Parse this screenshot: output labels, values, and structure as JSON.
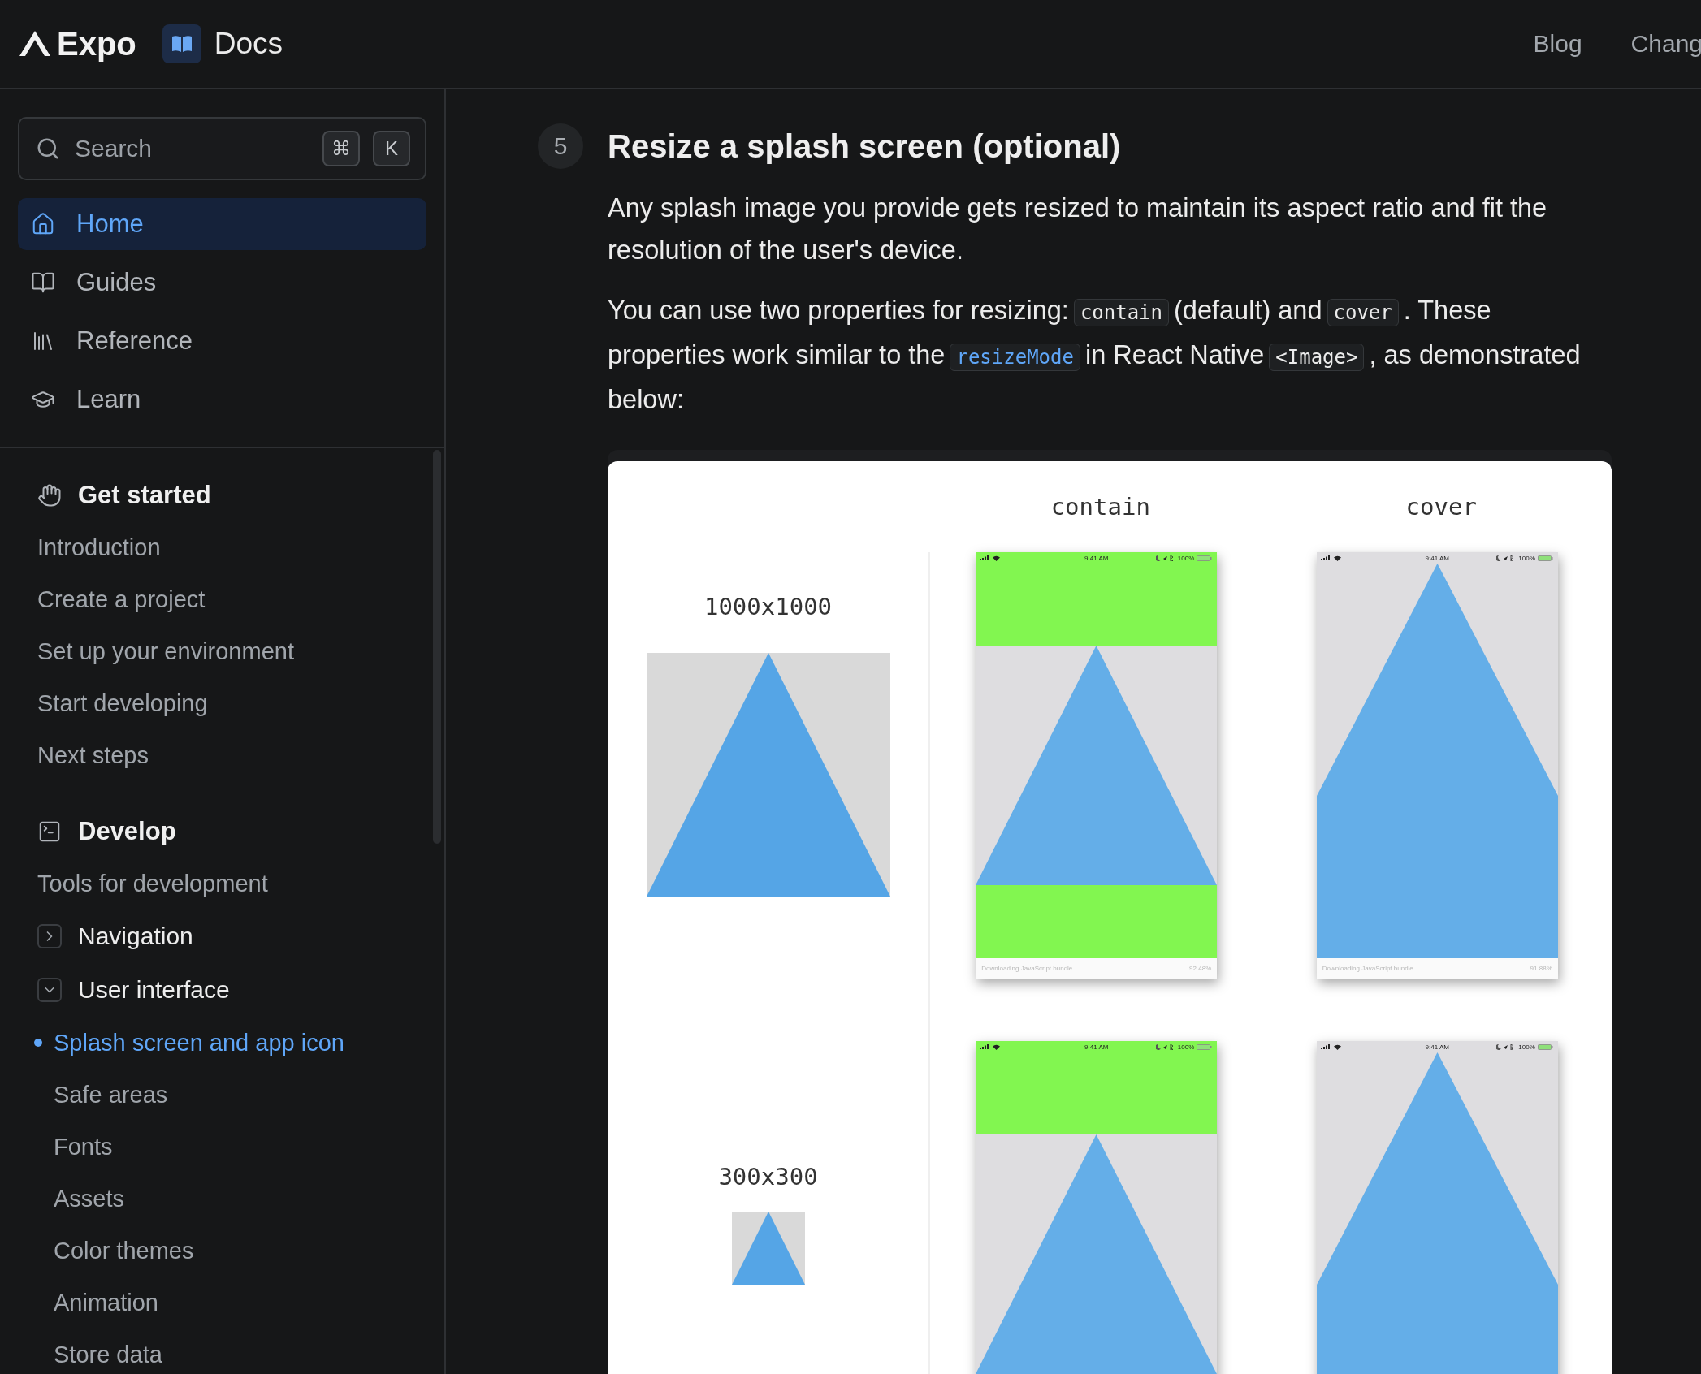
{
  "header": {
    "logo": "Expo",
    "section": "Docs",
    "links": [
      "Blog",
      "Chang"
    ]
  },
  "search": {
    "placeholder": "Search",
    "keys": [
      "⌘",
      "K"
    ]
  },
  "primary_nav": [
    {
      "label": "Home",
      "selected": true
    },
    {
      "label": "Guides",
      "selected": false
    },
    {
      "label": "Reference",
      "selected": false
    },
    {
      "label": "Learn",
      "selected": false
    }
  ],
  "sections": [
    {
      "title": "Get started",
      "items": [
        {
          "kind": "link",
          "label": "Introduction",
          "selected": false
        },
        {
          "kind": "link",
          "label": "Create a project",
          "selected": false
        },
        {
          "kind": "link",
          "label": "Set up your environment",
          "selected": false
        },
        {
          "kind": "link",
          "label": "Start developing",
          "selected": false
        },
        {
          "kind": "link",
          "label": "Next steps",
          "selected": false
        }
      ]
    },
    {
      "title": "Develop",
      "items": [
        {
          "kind": "link",
          "label": "Tools for development",
          "selected": false
        },
        {
          "kind": "group",
          "label": "Navigation",
          "expanded": false
        },
        {
          "kind": "group",
          "label": "User interface",
          "expanded": true,
          "children": [
            {
              "label": "Splash screen and app icon",
              "selected": true
            },
            {
              "label": "Safe areas",
              "selected": false
            },
            {
              "label": "Fonts",
              "selected": false
            },
            {
              "label": "Assets",
              "selected": false
            },
            {
              "label": "Color themes",
              "selected": false
            },
            {
              "label": "Animation",
              "selected": false
            },
            {
              "label": "Store data",
              "selected": false
            }
          ]
        }
      ]
    }
  ],
  "content": {
    "step": "5",
    "heading": "Resize a splash screen (optional)",
    "paragraphs": [
      [
        {
          "kind": "text",
          "text": "Any splash image you provide gets resized to maintain its aspect ratio and fit the resolution of the user's device."
        }
      ],
      [
        {
          "kind": "text",
          "text": "You can use two properties for resizing:"
        },
        {
          "kind": "code",
          "text": "contain"
        },
        {
          "kind": "text",
          "text": "(default) and"
        },
        {
          "kind": "code",
          "text": "cover"
        },
        {
          "kind": "text",
          "text": ". These properties work similar to the"
        },
        {
          "kind": "code_link",
          "text": "resizeMode"
        },
        {
          "kind": "text",
          "text": "in React Native"
        },
        {
          "kind": "code",
          "text": "<Image>"
        },
        {
          "kind": "text",
          "text": ", as demonstrated below:"
        }
      ]
    ],
    "figure": {
      "columns": [
        "contain",
        "cover"
      ],
      "rows": [
        {
          "size": "1000x1000",
          "kind": "large",
          "phones": [
            {
              "kind": "contain",
              "time": "9:41 AM",
              "battery": "100%",
              "loading": "Downloading JavaScript bundle",
              "percent": "92.48%"
            },
            {
              "kind": "cover",
              "time": "9:41 AM",
              "battery": "100%",
              "loading": "Downloading JavaScript bundle",
              "percent": "91.88%"
            }
          ]
        },
        {
          "size": "300x300",
          "kind": "small",
          "phones": [
            {
              "kind": "contain",
              "time": "9:41 AM",
              "battery": "100%"
            },
            {
              "kind": "cover",
              "time": "9:41 AM",
              "battery": "100%"
            }
          ]
        }
      ]
    }
  }
}
